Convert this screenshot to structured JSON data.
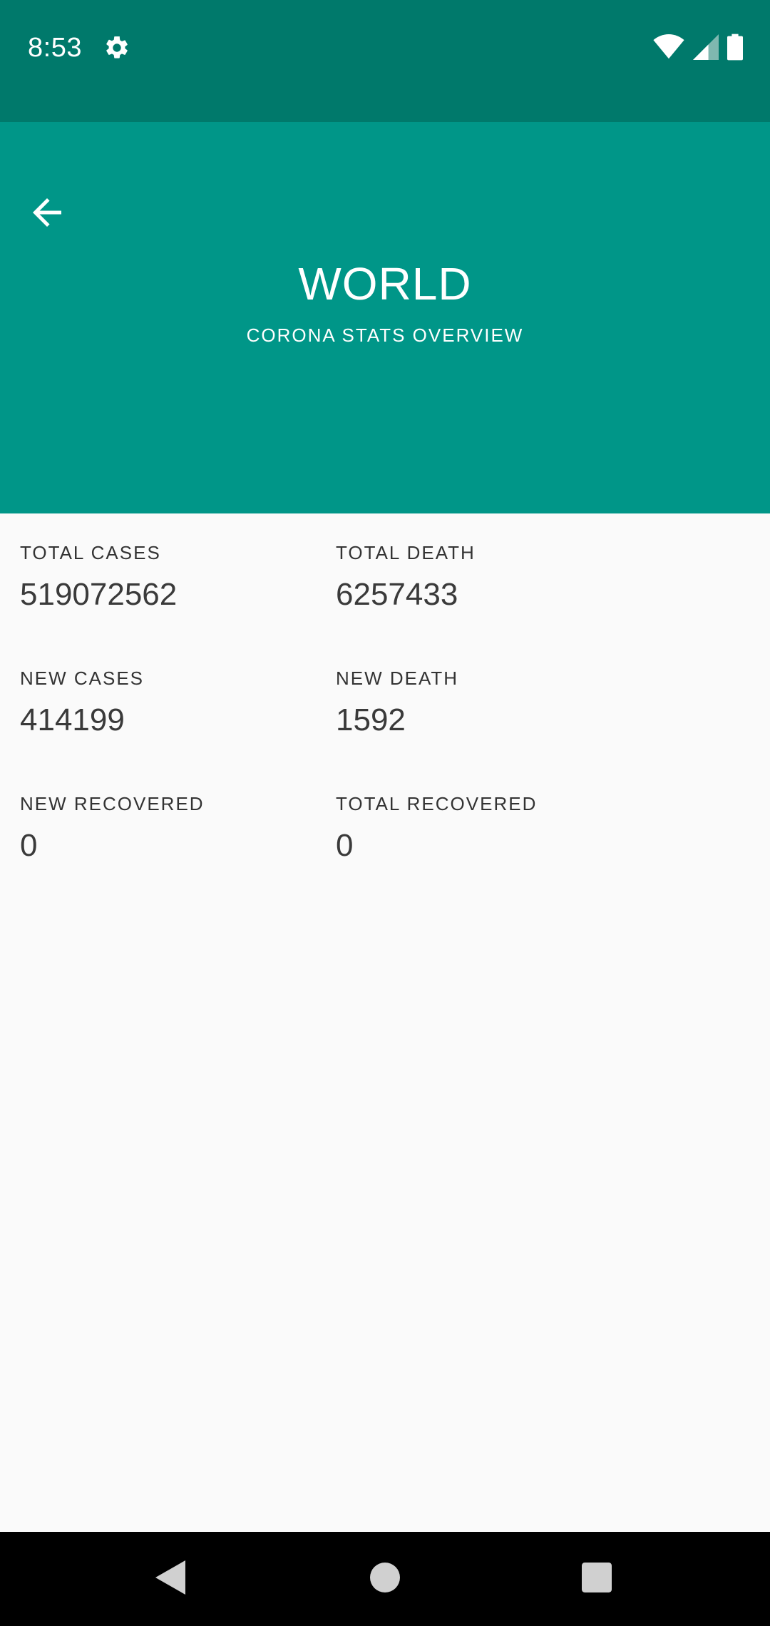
{
  "status_bar": {
    "time": "8:53",
    "icons": [
      "gear-icon",
      "wifi-icon",
      "cell-signal-icon",
      "battery-icon"
    ]
  },
  "header": {
    "title": "WORLD",
    "subtitle": "CORONA STATS OVERVIEW",
    "back_icon": "arrow-back-icon",
    "background": "#009688",
    "status_background": "#00796b"
  },
  "stats": [
    {
      "label": "TOTAL CASES",
      "value": "519072562"
    },
    {
      "label": "TOTAL DEATH",
      "value": "6257433"
    },
    {
      "label": "NEW CASES",
      "value": "414199"
    },
    {
      "label": "NEW DEATH",
      "value": "1592"
    },
    {
      "label": "NEW RECOVERED",
      "value": "0"
    },
    {
      "label": "TOTAL RECOVERED",
      "value": "0"
    }
  ],
  "nav_bar": {
    "icons": [
      "back-triangle-icon",
      "home-circle-icon",
      "recents-square-icon"
    ]
  }
}
